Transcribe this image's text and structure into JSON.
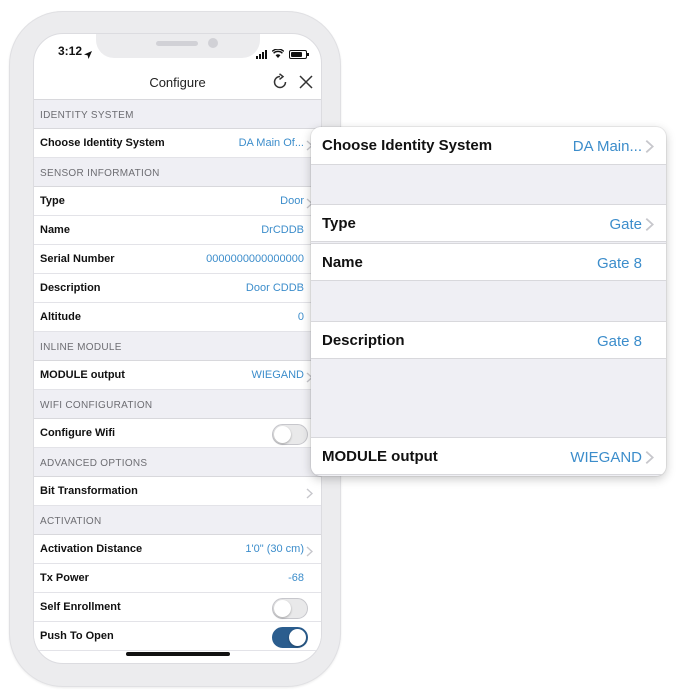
{
  "status_bar": {
    "time": "3:12"
  },
  "nav": {
    "title": "Configure"
  },
  "sections": [
    {
      "header": "IDENTITY SYSTEM",
      "rows": [
        {
          "label": "Choose Identity System",
          "value": "DA Main Of...",
          "kind": "chevron"
        }
      ]
    },
    {
      "header": "SENSOR INFORMATION",
      "rows": [
        {
          "label": "Type",
          "value": "Door",
          "kind": "chevron"
        },
        {
          "label": "Name",
          "value": "DrCDDB",
          "kind": "value"
        },
        {
          "label": "Serial Number",
          "value": "0000000000000000",
          "kind": "value"
        },
        {
          "label": "Description",
          "value": "Door CDDB",
          "kind": "value"
        },
        {
          "label": "Altitude",
          "value": "0",
          "kind": "value"
        }
      ]
    },
    {
      "header": "INLINE MODULE",
      "rows": [
        {
          "label": "MODULE output",
          "value": "WIEGAND",
          "kind": "chevron"
        }
      ]
    },
    {
      "header": "WIFI CONFIGURATION",
      "rows": [
        {
          "label": "Configure Wifi",
          "value": "",
          "kind": "toggle",
          "on": false
        }
      ]
    },
    {
      "header": "ADVANCED OPTIONS",
      "rows": [
        {
          "label": "Bit Transformation",
          "value": "",
          "kind": "chevron"
        }
      ]
    },
    {
      "header": "ACTIVATION",
      "rows": [
        {
          "label": "Activation Distance",
          "value": "1'0\" (30 cm)",
          "kind": "chevron"
        },
        {
          "label": "Tx Power",
          "value": "-68",
          "kind": "value"
        },
        {
          "label": "Self Enrollment",
          "value": "",
          "kind": "toggle",
          "on": false
        },
        {
          "label": "Push To Open",
          "value": "",
          "kind": "toggle",
          "on": true
        }
      ]
    }
  ],
  "zoom": {
    "rows": [
      {
        "label": "Choose Identity System",
        "value": "DA Main...",
        "chevron": true
      },
      {
        "label": "Type",
        "value": "Gate",
        "chevron": true
      },
      {
        "label": "Name",
        "value": "Gate 8",
        "chevron": false
      },
      {
        "label": "Description",
        "value": "Gate  8",
        "chevron": false
      },
      {
        "label": "MODULE output",
        "value": "WIEGAND",
        "chevron": true
      }
    ]
  },
  "colors": {
    "accent_value": "#3c8dcb",
    "toggle_on": "#2b5d8e",
    "section_bg": "#efeff4"
  },
  "icons": {
    "nav_refresh": "refresh-icon",
    "nav_close": "close-icon",
    "row_disclosure": "chevron-right-icon"
  }
}
